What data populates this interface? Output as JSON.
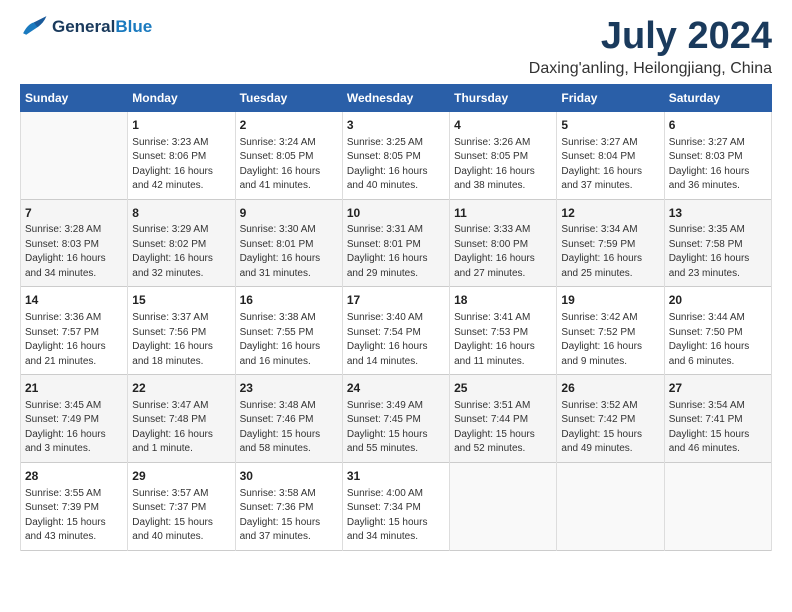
{
  "logo": {
    "line1": "General",
    "line2": "Blue"
  },
  "title": "July 2024",
  "location": "Daxing'anling, Heilongjiang, China",
  "days_header": [
    "Sunday",
    "Monday",
    "Tuesday",
    "Wednesday",
    "Thursday",
    "Friday",
    "Saturday"
  ],
  "weeks": [
    [
      {
        "day": "",
        "info": ""
      },
      {
        "day": "1",
        "info": "Sunrise: 3:23 AM\nSunset: 8:06 PM\nDaylight: 16 hours\nand 42 minutes."
      },
      {
        "day": "2",
        "info": "Sunrise: 3:24 AM\nSunset: 8:05 PM\nDaylight: 16 hours\nand 41 minutes."
      },
      {
        "day": "3",
        "info": "Sunrise: 3:25 AM\nSunset: 8:05 PM\nDaylight: 16 hours\nand 40 minutes."
      },
      {
        "day": "4",
        "info": "Sunrise: 3:26 AM\nSunset: 8:05 PM\nDaylight: 16 hours\nand 38 minutes."
      },
      {
        "day": "5",
        "info": "Sunrise: 3:27 AM\nSunset: 8:04 PM\nDaylight: 16 hours\nand 37 minutes."
      },
      {
        "day": "6",
        "info": "Sunrise: 3:27 AM\nSunset: 8:03 PM\nDaylight: 16 hours\nand 36 minutes."
      }
    ],
    [
      {
        "day": "7",
        "info": "Sunrise: 3:28 AM\nSunset: 8:03 PM\nDaylight: 16 hours\nand 34 minutes."
      },
      {
        "day": "8",
        "info": "Sunrise: 3:29 AM\nSunset: 8:02 PM\nDaylight: 16 hours\nand 32 minutes."
      },
      {
        "day": "9",
        "info": "Sunrise: 3:30 AM\nSunset: 8:01 PM\nDaylight: 16 hours\nand 31 minutes."
      },
      {
        "day": "10",
        "info": "Sunrise: 3:31 AM\nSunset: 8:01 PM\nDaylight: 16 hours\nand 29 minutes."
      },
      {
        "day": "11",
        "info": "Sunrise: 3:33 AM\nSunset: 8:00 PM\nDaylight: 16 hours\nand 27 minutes."
      },
      {
        "day": "12",
        "info": "Sunrise: 3:34 AM\nSunset: 7:59 PM\nDaylight: 16 hours\nand 25 minutes."
      },
      {
        "day": "13",
        "info": "Sunrise: 3:35 AM\nSunset: 7:58 PM\nDaylight: 16 hours\nand 23 minutes."
      }
    ],
    [
      {
        "day": "14",
        "info": "Sunrise: 3:36 AM\nSunset: 7:57 PM\nDaylight: 16 hours\nand 21 minutes."
      },
      {
        "day": "15",
        "info": "Sunrise: 3:37 AM\nSunset: 7:56 PM\nDaylight: 16 hours\nand 18 minutes."
      },
      {
        "day": "16",
        "info": "Sunrise: 3:38 AM\nSunset: 7:55 PM\nDaylight: 16 hours\nand 16 minutes."
      },
      {
        "day": "17",
        "info": "Sunrise: 3:40 AM\nSunset: 7:54 PM\nDaylight: 16 hours\nand 14 minutes."
      },
      {
        "day": "18",
        "info": "Sunrise: 3:41 AM\nSunset: 7:53 PM\nDaylight: 16 hours\nand 11 minutes."
      },
      {
        "day": "19",
        "info": "Sunrise: 3:42 AM\nSunset: 7:52 PM\nDaylight: 16 hours\nand 9 minutes."
      },
      {
        "day": "20",
        "info": "Sunrise: 3:44 AM\nSunset: 7:50 PM\nDaylight: 16 hours\nand 6 minutes."
      }
    ],
    [
      {
        "day": "21",
        "info": "Sunrise: 3:45 AM\nSunset: 7:49 PM\nDaylight: 16 hours\nand 3 minutes."
      },
      {
        "day": "22",
        "info": "Sunrise: 3:47 AM\nSunset: 7:48 PM\nDaylight: 16 hours\nand 1 minute."
      },
      {
        "day": "23",
        "info": "Sunrise: 3:48 AM\nSunset: 7:46 PM\nDaylight: 15 hours\nand 58 minutes."
      },
      {
        "day": "24",
        "info": "Sunrise: 3:49 AM\nSunset: 7:45 PM\nDaylight: 15 hours\nand 55 minutes."
      },
      {
        "day": "25",
        "info": "Sunrise: 3:51 AM\nSunset: 7:44 PM\nDaylight: 15 hours\nand 52 minutes."
      },
      {
        "day": "26",
        "info": "Sunrise: 3:52 AM\nSunset: 7:42 PM\nDaylight: 15 hours\nand 49 minutes."
      },
      {
        "day": "27",
        "info": "Sunrise: 3:54 AM\nSunset: 7:41 PM\nDaylight: 15 hours\nand 46 minutes."
      }
    ],
    [
      {
        "day": "28",
        "info": "Sunrise: 3:55 AM\nSunset: 7:39 PM\nDaylight: 15 hours\nand 43 minutes."
      },
      {
        "day": "29",
        "info": "Sunrise: 3:57 AM\nSunset: 7:37 PM\nDaylight: 15 hours\nand 40 minutes."
      },
      {
        "day": "30",
        "info": "Sunrise: 3:58 AM\nSunset: 7:36 PM\nDaylight: 15 hours\nand 37 minutes."
      },
      {
        "day": "31",
        "info": "Sunrise: 4:00 AM\nSunset: 7:34 PM\nDaylight: 15 hours\nand 34 minutes."
      },
      {
        "day": "",
        "info": ""
      },
      {
        "day": "",
        "info": ""
      },
      {
        "day": "",
        "info": ""
      }
    ]
  ]
}
